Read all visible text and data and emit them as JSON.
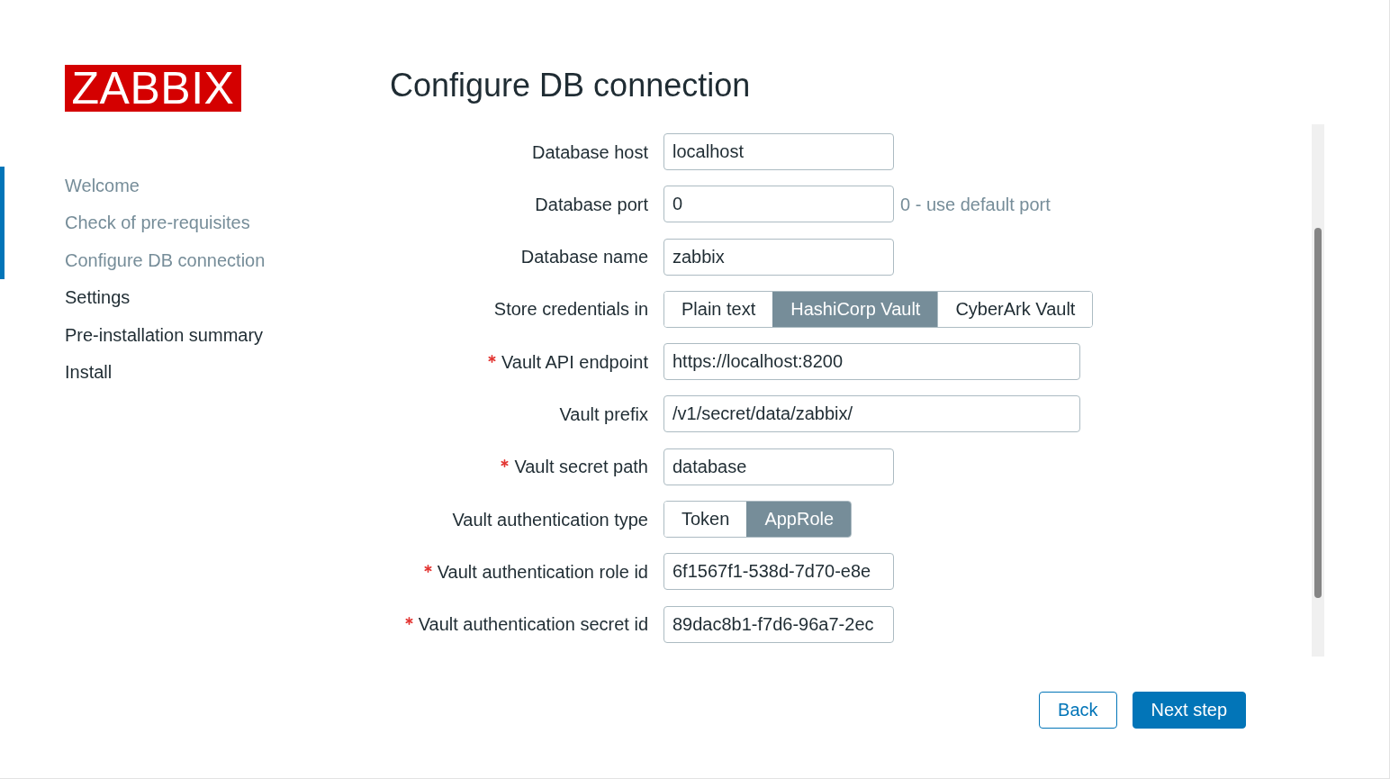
{
  "logo": {
    "text": "ZABBIX"
  },
  "steps": [
    {
      "label": "Welcome",
      "visited": true
    },
    {
      "label": "Check of pre-requisites",
      "visited": true
    },
    {
      "label": "Configure DB connection",
      "visited": true
    },
    {
      "label": "Settings",
      "visited": false
    },
    {
      "label": "Pre-installation summary",
      "visited": false
    },
    {
      "label": "Install",
      "visited": false
    }
  ],
  "title": "Configure DB connection",
  "fields": [
    {
      "kind": "text",
      "label": "Database host",
      "required": false,
      "value": "localhost"
    },
    {
      "kind": "text",
      "label": "Database port",
      "required": false,
      "value": "0",
      "hint": "0 - use default port"
    },
    {
      "kind": "text",
      "label": "Database name",
      "required": false,
      "value": "zabbix"
    },
    {
      "kind": "segmented",
      "label": "Store credentials in",
      "required": false,
      "options": [
        {
          "label": "Plain text",
          "selected": false
        },
        {
          "label": "HashiCorp Vault",
          "selected": true
        },
        {
          "label": "CyberArk Vault",
          "selected": false
        }
      ]
    },
    {
      "kind": "url",
      "label": "Vault API endpoint",
      "required": true,
      "value": "https://localhost:8200"
    },
    {
      "kind": "url",
      "label": "Vault prefix",
      "required": false,
      "value": "/v1/secret/data/zabbix/"
    },
    {
      "kind": "text",
      "label": "Vault secret path",
      "required": true,
      "value": "database"
    },
    {
      "kind": "segmented",
      "label": "Vault authentication type",
      "required": false,
      "options": [
        {
          "label": "Token",
          "selected": false
        },
        {
          "label": "AppRole",
          "selected": true
        }
      ]
    },
    {
      "kind": "text",
      "label": "Vault authentication role id",
      "required": true,
      "value": "6f1567f1-538d-7d70-e8e"
    },
    {
      "kind": "text",
      "label": "Vault authentication secret id",
      "required": true,
      "value": "89dac8b1-f7d6-96a7-2ec"
    }
  ],
  "buttons": [
    {
      "kind": "secondary",
      "label": "Back"
    },
    {
      "kind": "primary",
      "label": "Next step"
    }
  ]
}
